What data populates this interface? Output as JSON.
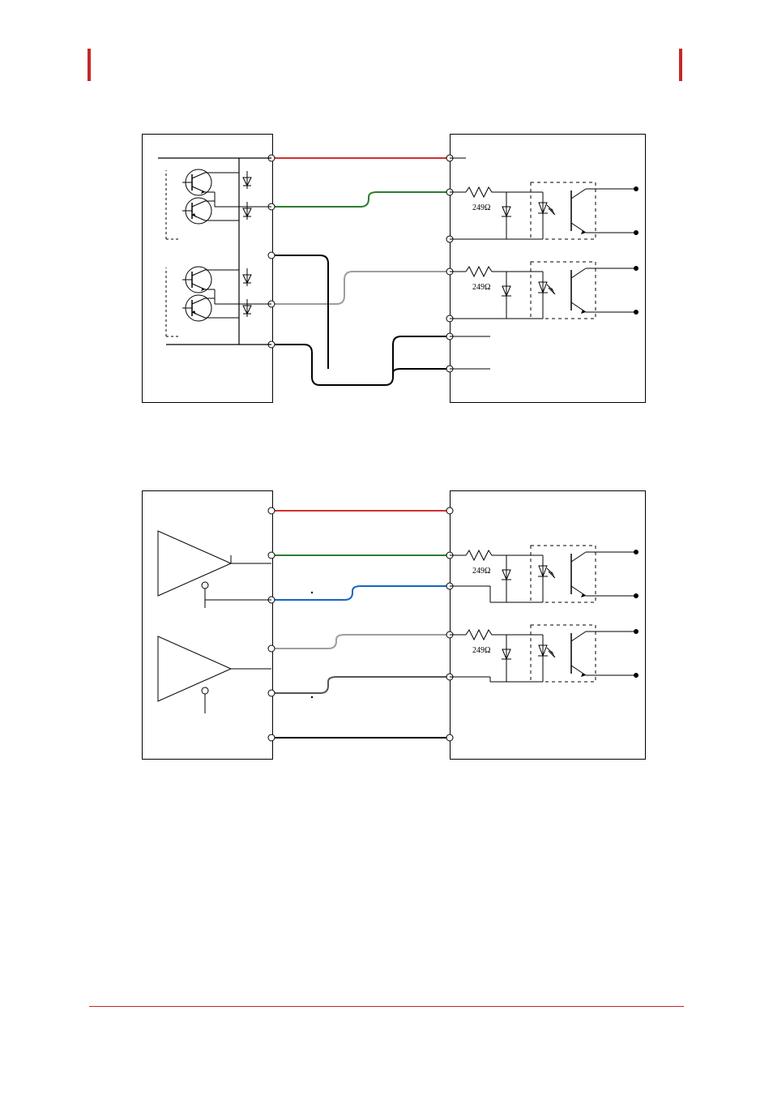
{
  "resistor": {
    "value": "249Ω"
  },
  "diagram_top": {},
  "diagram_bottom": {}
}
